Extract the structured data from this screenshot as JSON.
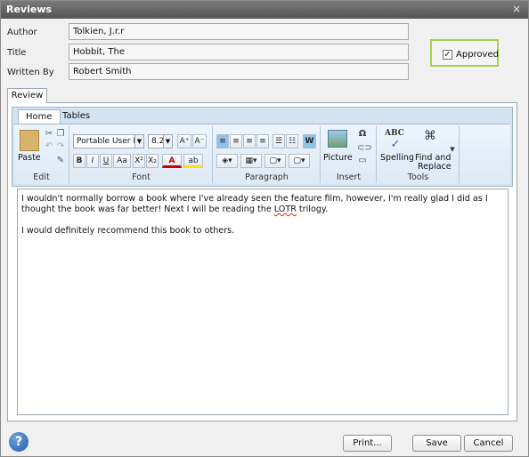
{
  "window": {
    "title": "Reviews",
    "close_glyph": "×"
  },
  "form": {
    "author_label": "Author",
    "author_value": "Tolkien, J.r.r",
    "title_label": "Title",
    "title_value": "Hobbit, The",
    "writtenby_label": "Written By",
    "writtenby_value": "Robert Smith",
    "approved_label": "Approved",
    "approved_checked": true,
    "approved_check_glyph": "✓",
    "approved_highlight_color": "#a8d04a"
  },
  "tabs": {
    "review": "Review"
  },
  "ribbon": {
    "tabs": [
      "Home",
      "Tables"
    ],
    "groups": {
      "edit": "Edit",
      "font": "Font",
      "paragraph": "Paragraph",
      "insert": "Insert",
      "tools": "Tools"
    },
    "paste_label": "Paste",
    "font_family": "Portable User Ir",
    "font_size": "8.2",
    "grow_font": "A⁺",
    "shrink_font": "A⁻",
    "bold": "B",
    "italic": "I",
    "underline": "U",
    "case": "Aa",
    "superscript": "X²",
    "subscript": "X₂",
    "font_color": "A",
    "highlight": "ab",
    "picture_label": "Picture",
    "symbol_glyph": "Ω",
    "spelling_label": "Spelling",
    "spelling_glyph": "ABC",
    "find_replace_label_1": "Find and",
    "find_replace_label_2": "Replace",
    "wrap_label": "W"
  },
  "editor": {
    "paragraph1_before": "I wouldn't normally borrow a book where I've already seen the feature film, however, I'm really glad I did as I thought the book was far better! Next I will be reading the ",
    "paragraph1_spell": "LOTR",
    "paragraph1_after": " trilogy.",
    "paragraph2": "I would definitely recommend this book to others."
  },
  "footer": {
    "help_glyph": "?",
    "print": "Print...",
    "save": "Save",
    "cancel": "Cancel"
  }
}
